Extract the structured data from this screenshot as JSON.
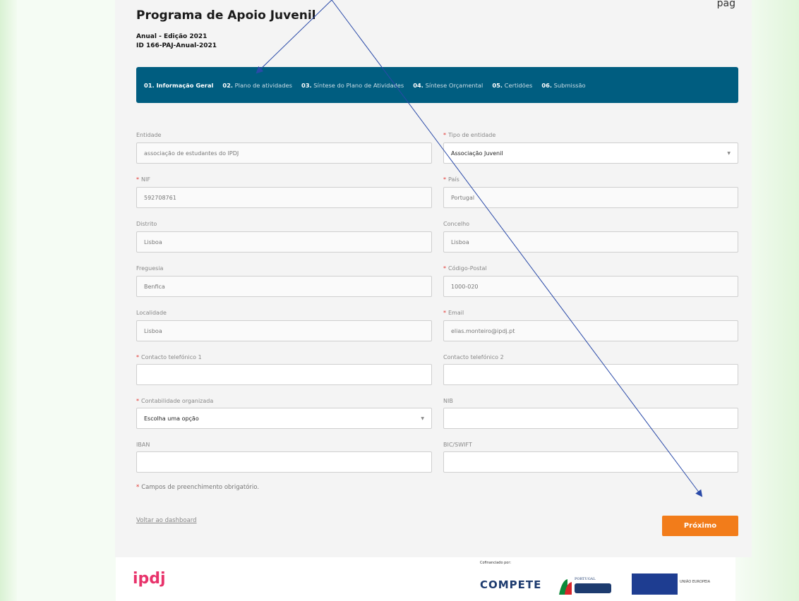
{
  "header": {
    "title": "Programa de Apoio Juvenil",
    "subtitle_line1": "Anual - Edição 2021",
    "subtitle_line2": "ID 166-PAJ-Anual-2021",
    "top_right_fragment": "pág"
  },
  "tabs": [
    {
      "num": "01.",
      "label": " Informação Geral",
      "active": true
    },
    {
      "num": "02.",
      "label": " Plano de atividades",
      "active": false
    },
    {
      "num": "03.",
      "label": " Síntese do Plano de Atividades",
      "active": false
    },
    {
      "num": "04.",
      "label": " Síntese Orçamental",
      "active": false
    },
    {
      "num": "05.",
      "label": " Certidões",
      "active": false
    },
    {
      "num": "06.",
      "label": " Submissão",
      "active": false
    }
  ],
  "form": {
    "entidade": {
      "label": "Entidade",
      "value": "associação de estudantes do IPDJ"
    },
    "tipo_entidade": {
      "label": "Tipo de entidade",
      "value": "Associação Juvenil"
    },
    "nif": {
      "label": "NIF",
      "value": "592708761"
    },
    "pais": {
      "label": "País",
      "value": "Portugal"
    },
    "distrito": {
      "label": "Distrito",
      "value": "Lisboa"
    },
    "concelho": {
      "label": "Concelho",
      "value": "Lisboa"
    },
    "freguesia": {
      "label": "Freguesia",
      "value": "Benfica"
    },
    "codigo_postal": {
      "label": "Código-Postal",
      "value": "1000-020"
    },
    "localidade": {
      "label": "Localidade",
      "value": "Lisboa"
    },
    "email": {
      "label": "Email",
      "value": "elias.monteiro@ipdj.pt"
    },
    "contacto1": {
      "label": "Contacto telefónico 1",
      "value": ""
    },
    "contacto2": {
      "label": "Contacto telefónico 2",
      "value": ""
    },
    "contabilidade": {
      "label": "Contabilidade organizada",
      "value": "Escolha uma opção"
    },
    "nib": {
      "label": "NIB",
      "value": ""
    },
    "iban": {
      "label": "IBAN",
      "value": ""
    },
    "bic": {
      "label": "BIC/SWIFT",
      "value": ""
    }
  },
  "required_note": "Campos de preenchimento obrigatório.",
  "required_marker": "*",
  "back_link": "Voltar ao dashboard",
  "next_button": "Próximo",
  "footer": {
    "ipdj": "ipdj",
    "cofinanciado": "Cofinanciado por:",
    "compete": "COMPETE",
    "portugal": "PORTUGAL",
    "eu_text": "UNIÃO EUROPEIA"
  },
  "colors": {
    "tab_bar": "#005d80",
    "primary_button": "#f27c1a",
    "required": "#e3342f",
    "annotation_arrow": "#2a4aa8"
  }
}
